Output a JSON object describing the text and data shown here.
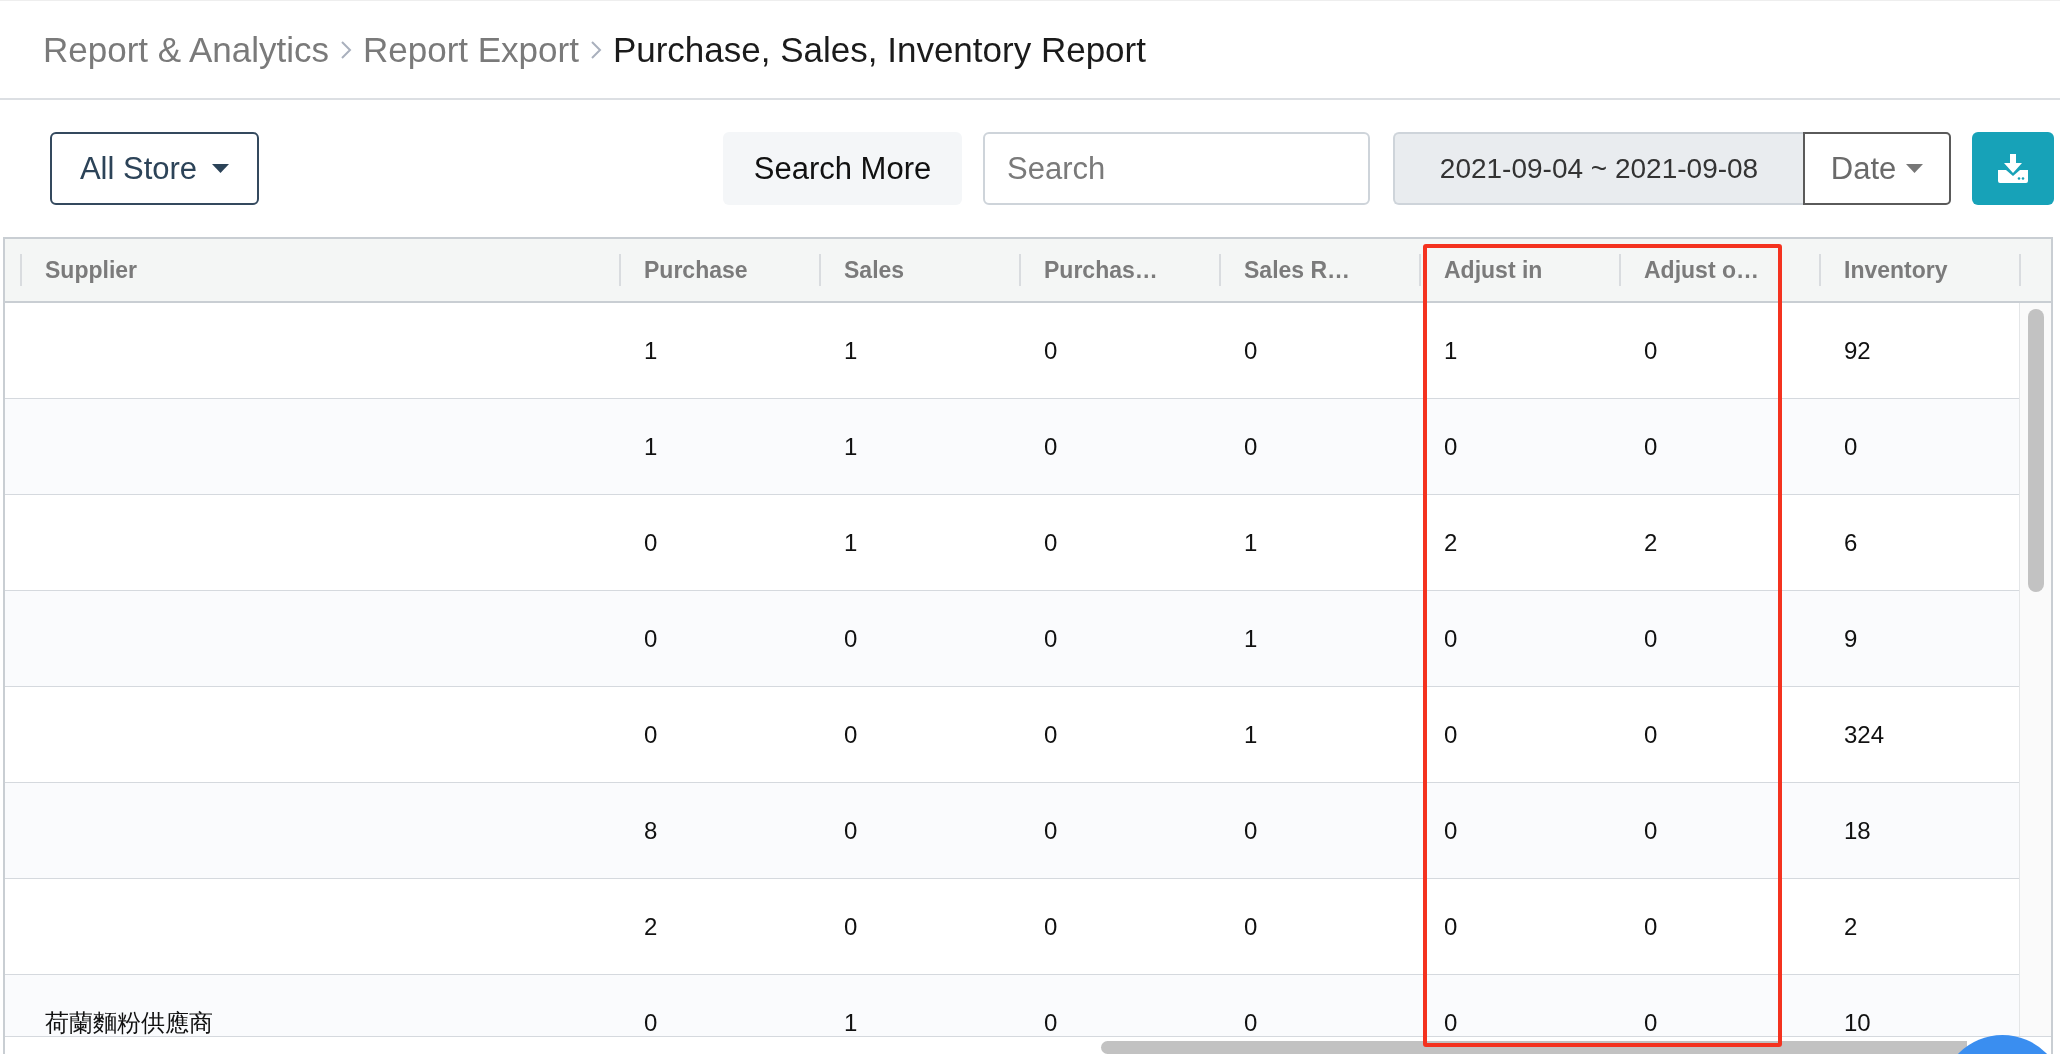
{
  "breadcrumb": [
    {
      "label": "Report & Analytics",
      "current": false
    },
    {
      "label": "Report Export",
      "current": false
    },
    {
      "label": "Purchase, Sales, Inventory Report",
      "current": true
    }
  ],
  "toolbar": {
    "store_filter": {
      "value": "All Store"
    },
    "search_more": {
      "label": "Search More"
    },
    "search": {
      "placeholder": "Search"
    },
    "date_range": {
      "value": "2021-09-04 ~ 2021-09-08"
    },
    "date_type": {
      "value": "Date"
    }
  },
  "table": {
    "columns": [
      {
        "label": "Supplier",
        "highlighted": false
      },
      {
        "label": "Purchase",
        "highlighted": false
      },
      {
        "label": "Sales",
        "highlighted": false
      },
      {
        "label": "Purchas…",
        "highlighted": false
      },
      {
        "label": "Sales R…",
        "highlighted": false
      },
      {
        "label": "Adjust in",
        "highlighted": true
      },
      {
        "label": "Adjust o…",
        "highlighted": true
      },
      {
        "label": "Inventory",
        "highlighted": false
      }
    ],
    "rows": [
      {
        "cells": [
          "",
          "1",
          "1",
          "0",
          "0",
          "1",
          "0",
          "92"
        ]
      },
      {
        "cells": [
          "",
          "1",
          "1",
          "0",
          "0",
          "0",
          "0",
          "0"
        ]
      },
      {
        "cells": [
          "",
          "0",
          "1",
          "0",
          "1",
          "2",
          "2",
          "6"
        ]
      },
      {
        "cells": [
          "",
          "0",
          "0",
          "0",
          "1",
          "0",
          "0",
          "9"
        ]
      },
      {
        "cells": [
          "",
          "0",
          "0",
          "0",
          "1",
          "0",
          "0",
          "324"
        ]
      },
      {
        "cells": [
          "",
          "8",
          "0",
          "0",
          "0",
          "0",
          "0",
          "18"
        ]
      },
      {
        "cells": [
          "",
          "2",
          "0",
          "0",
          "0",
          "0",
          "0",
          "2"
        ]
      },
      {
        "cells": [
          "荷蘭麵粉供應商",
          "0",
          "1",
          "0",
          "0",
          "0",
          "0",
          "10"
        ]
      }
    ]
  }
}
